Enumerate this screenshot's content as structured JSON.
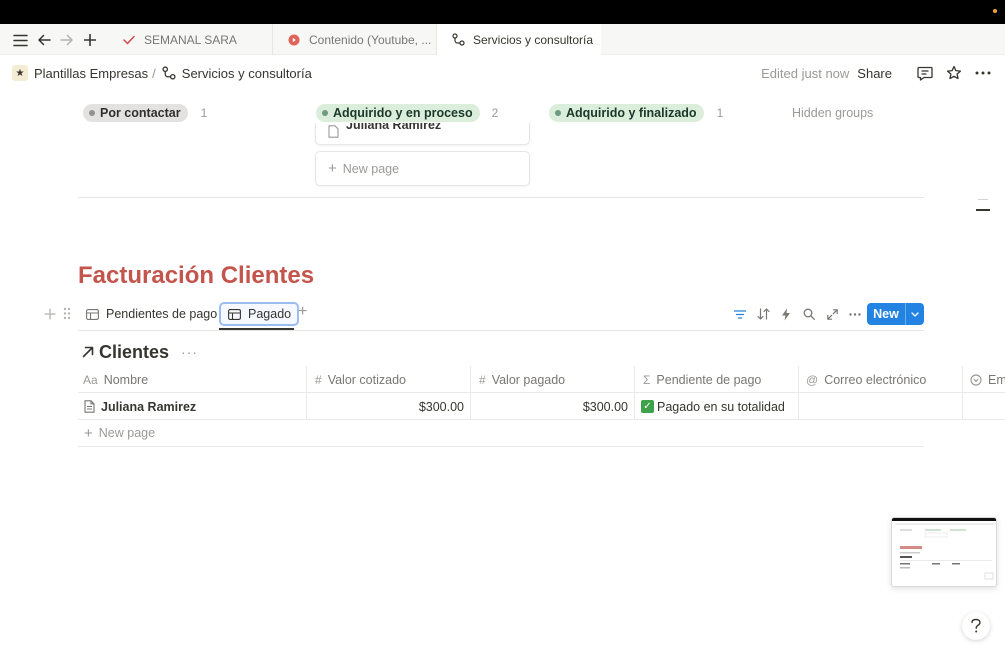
{
  "tabs": [
    {
      "label": "SEMANAL SARA",
      "icon": "check-icon"
    },
    {
      "label": "Contenido (Youtube, ...",
      "icon": "youtube-icon"
    },
    {
      "label": "Servicios y consultoría",
      "icon": "network-icon",
      "active": true
    }
  ],
  "breadcrumb": {
    "workspace": "Plantillas Empresas",
    "separator": "/",
    "page": "Servicios y consultoría"
  },
  "header": {
    "edited": "Edited just now",
    "share": "Share"
  },
  "board": {
    "groups": [
      {
        "label": "Por contactar",
        "count": "1",
        "color": "gray"
      },
      {
        "label": "Adquirido y en proceso",
        "count": "2",
        "color": "green"
      },
      {
        "label": "Adquirido y finalizado",
        "count": "1",
        "color": "green"
      }
    ],
    "hidden_groups": "Hidden groups",
    "card_partial": "Juliana Ramirez",
    "new_page": "New page"
  },
  "page_title": "Facturación Clientes",
  "views": {
    "tabs": [
      {
        "label": "Pendientes de pago"
      },
      {
        "label": "Pagado",
        "active": true
      }
    ],
    "add": "+",
    "new_button": "New"
  },
  "database": {
    "title": "Clientes",
    "more": "···",
    "columns": [
      {
        "label": "Nombre",
        "icon": "Aa"
      },
      {
        "label": "Valor cotizado",
        "icon": "#"
      },
      {
        "label": "Valor pagado",
        "icon": "#"
      },
      {
        "label": "Pendiente de pago",
        "icon": "Σ"
      },
      {
        "label": "Correo electrónico",
        "icon": "@"
      },
      {
        "label": "Em",
        "icon": "status-icon"
      }
    ],
    "rows": [
      {
        "nombre": "Juliana Ramirez",
        "valor_cotizado": "$300.00",
        "valor_pagado": "$300.00",
        "pendiente": "Pagado en su totalidad",
        "correo": ""
      }
    ],
    "new_page": "New page"
  },
  "colors": {
    "title_red": "#c4554d",
    "accent_blue": "#2383e2",
    "pill_green": "#dbeddb",
    "pill_gray": "#e3e2e0"
  }
}
